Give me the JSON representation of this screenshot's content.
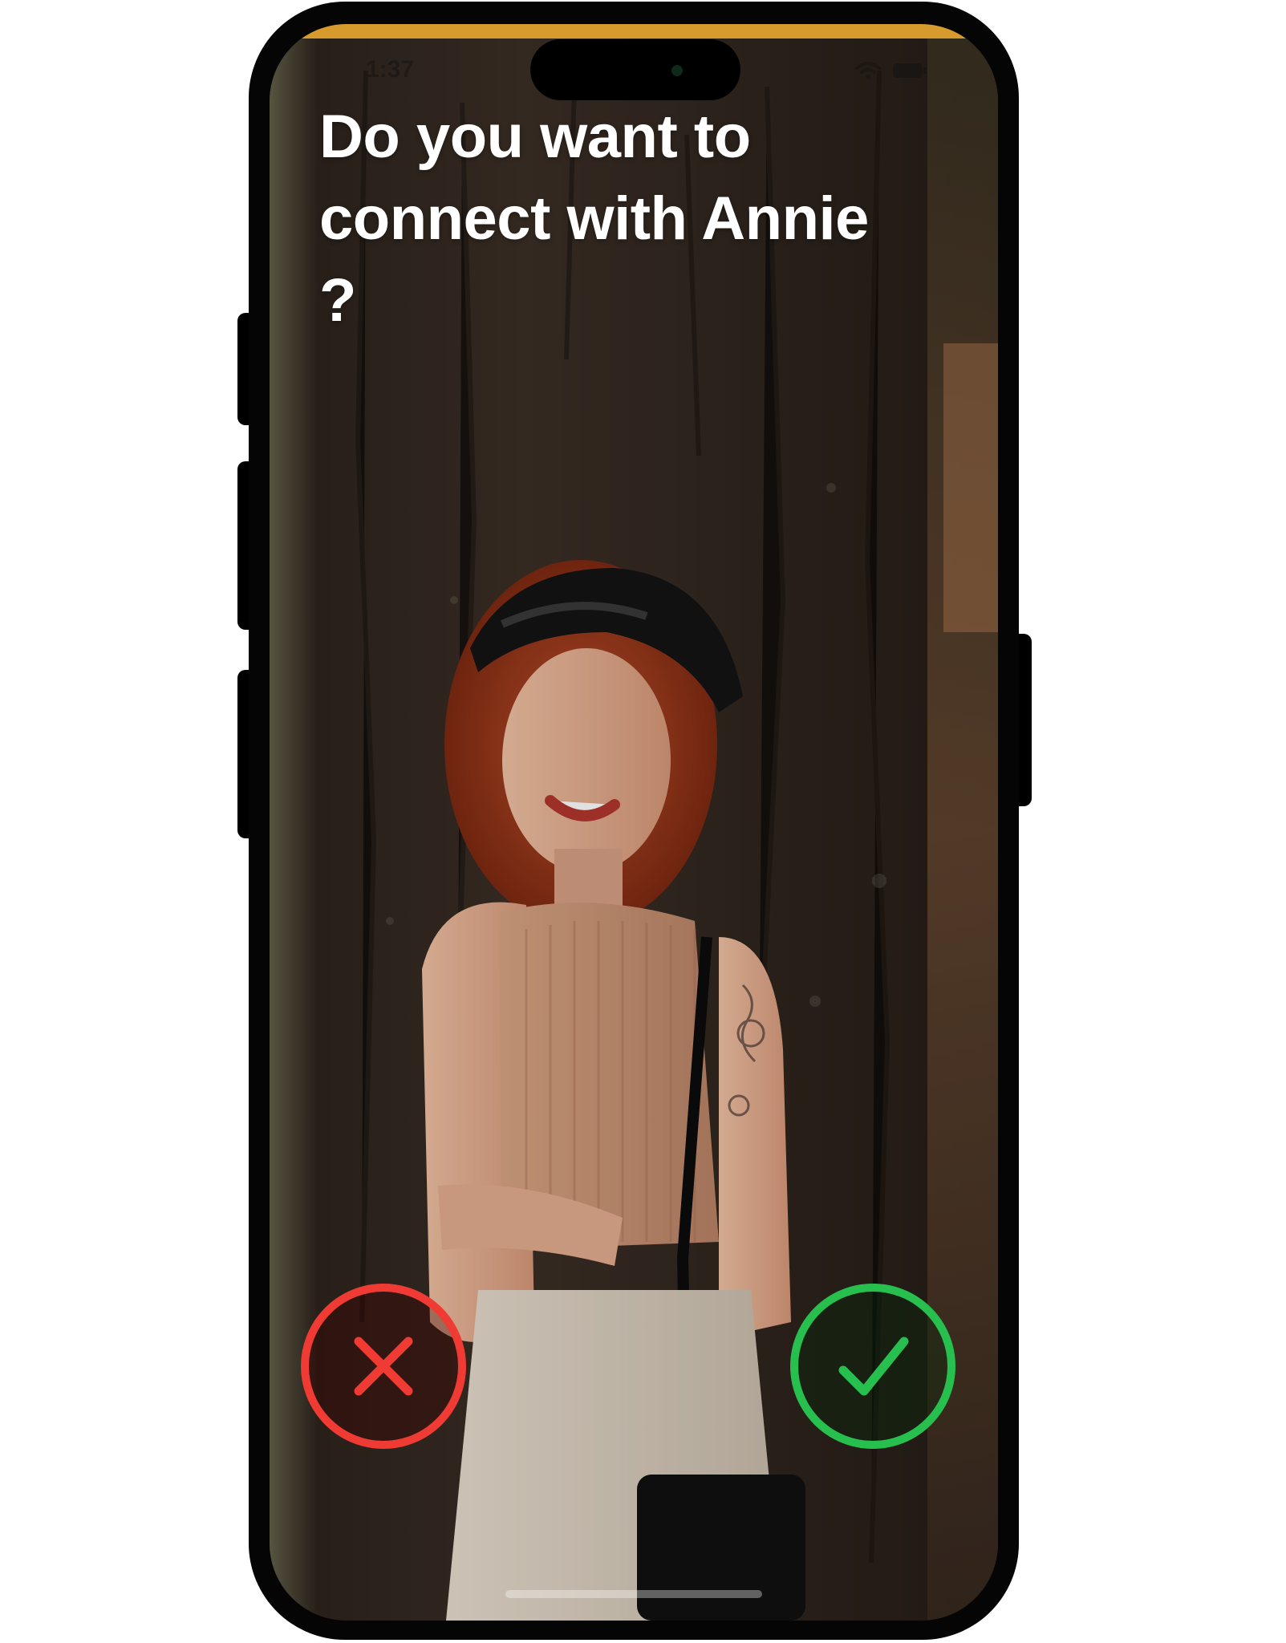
{
  "status_bar": {
    "time": "1:37",
    "icons": [
      "wifi-icon",
      "battery-icon"
    ]
  },
  "prompt": {
    "title": "Do you want to connect with Annie ?"
  },
  "actions": {
    "decline_icon": "close-icon",
    "accept_icon": "checkmark-icon"
  },
  "colors": {
    "accent_bar": "#d79a2d",
    "decline": "#ef3b33",
    "accept": "#27c04f",
    "title_text": "#ffffff"
  }
}
